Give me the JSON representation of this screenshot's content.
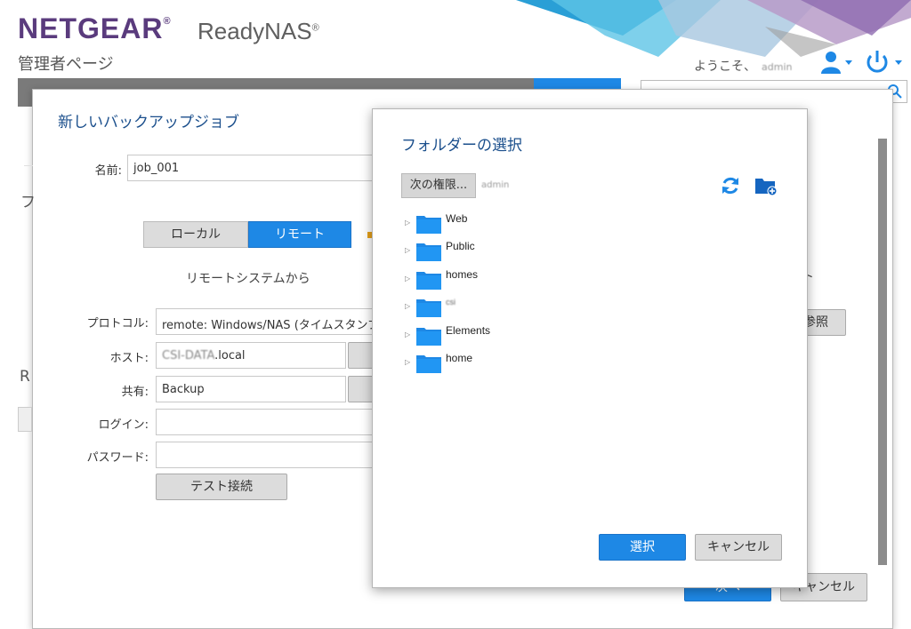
{
  "header": {
    "brand": "NETGEAR",
    "brand_mark": "®",
    "product": "ReadyNAS",
    "product_mark": "®",
    "admin_page": "管理者ページ",
    "welcome": "ようこそ、",
    "username": "admin"
  },
  "colors": {
    "brand": "#5a3b7d",
    "accent": "#1e88e5",
    "title": "#1b4f8c"
  },
  "backup_dialog": {
    "title": "新しいバックアップジョブ",
    "name_label": "名前:",
    "name_value": "job_001",
    "toggle_local": "ローカル",
    "toggle_remote": "リモート",
    "from_remote": "リモートシステムから",
    "protocol_label": "プロトコル:",
    "protocol_value": "remote: Windows/NAS (タイムスタンプ",
    "host_label": "ホスト:",
    "host_value_masked": "CSI-DATA",
    "host_value_suffix": ".local",
    "share_label": "共有:",
    "share_value": "Backup",
    "login_label": "ログイン:",
    "password_label": "パスワード:",
    "test_button": "テスト接続",
    "right_fragment": "ート",
    "browse_button": "参照",
    "next_button": "次へ",
    "cancel_button": "キャンセル",
    "left_fragment_f": "フ",
    "left_fragment_r": "R"
  },
  "folder_dialog": {
    "title": "フォルダーの選択",
    "next_perm_button": "次の権限...",
    "perm_user": "admin",
    "refresh_icon": "refresh-icon",
    "new_folder_icon": "new-folder-icon",
    "folders": [
      {
        "name": "Web",
        "blurred": false
      },
      {
        "name": "Public",
        "blurred": false
      },
      {
        "name": "homes",
        "blurred": false
      },
      {
        "name": "csi",
        "blurred": true
      },
      {
        "name": "Elements",
        "blurred": false
      },
      {
        "name": "home",
        "blurred": false
      }
    ],
    "select_button": "選択",
    "cancel_button": "キャンセル"
  }
}
